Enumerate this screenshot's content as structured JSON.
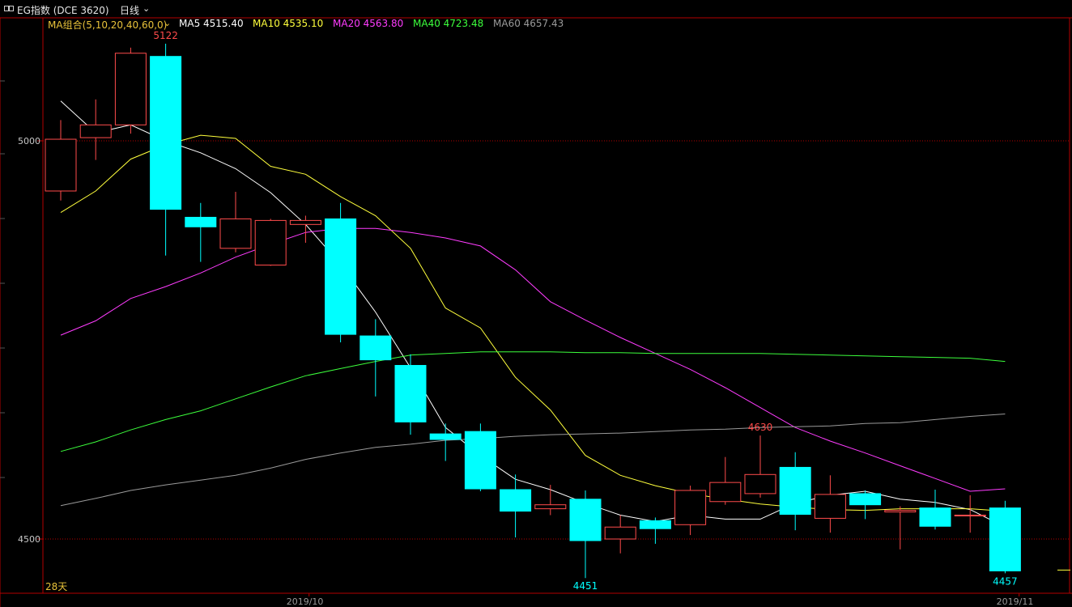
{
  "header": {
    "symbol": "EG指数  (DCE 3620)",
    "period": "日线",
    "period_menu_icon": "chevron-down-icon",
    "window_icon": "window-toggle-icon"
  },
  "legend": {
    "combo": "MA组合(5,10,20,40,60,0)",
    "ma5": "MA5 4515.40",
    "ma10": "MA10 4535.10",
    "ma20": "MA20 4563.80",
    "ma40": "MA40 4723.48",
    "ma60": "MA60 4657.43"
  },
  "colors": {
    "up": "#ff4b4b",
    "down": "#00ffff",
    "ma5": "#ffffff",
    "ma10": "#ffff3c",
    "ma20": "#ff3cff",
    "ma40": "#3cff3c",
    "ma60": "#9a9a9a",
    "frame": "#b40000",
    "combo": "#e8c23a"
  },
  "footer": {
    "days": "28天"
  },
  "chart_data": {
    "type": "candlestick",
    "y_ticks": [
      {
        "value": 5000,
        "label": "5000"
      },
      {
        "value": 4500,
        "label": "4500"
      }
    ],
    "x_labels": [
      {
        "at": 7.1,
        "label": "2019/10"
      },
      {
        "at": 27.4,
        "label": "2019/11"
      }
    ],
    "candles": [
      {
        "open": 4937,
        "close": 5002,
        "high": 5026,
        "low": 4925
      },
      {
        "open": 5004,
        "close": 5020,
        "high": 5052,
        "low": 4976
      },
      {
        "open": 5020,
        "close": 5110,
        "high": 5117,
        "low": 5009
      },
      {
        "open": 5106,
        "close": 4914,
        "high": 5122,
        "low": 4856
      },
      {
        "open": 4904,
        "close": 4892,
        "high": 4922,
        "low": 4848
      },
      {
        "open": 4865,
        "close": 4902,
        "high": 4936,
        "low": 4860
      },
      {
        "open": 4844,
        "close": 4900,
        "high": 4902,
        "low": 4843
      },
      {
        "open": 4895,
        "close": 4900,
        "high": 4906,
        "low": 4872
      },
      {
        "open": 4902,
        "close": 4757,
        "high": 4922,
        "low": 4747
      },
      {
        "open": 4755,
        "close": 4725,
        "high": 4776,
        "low": 4679
      },
      {
        "open": 4718,
        "close": 4647,
        "high": 4732,
        "low": 4631
      },
      {
        "open": 4632,
        "close": 4625,
        "high": 4645,
        "low": 4598
      },
      {
        "open": 4635,
        "close": 4563,
        "high": 4645,
        "low": 4560
      },
      {
        "open": 4562,
        "close": 4535,
        "high": 4581,
        "low": 4502
      },
      {
        "open": 4538,
        "close": 4543,
        "high": 4568,
        "low": 4530
      },
      {
        "open": 4550,
        "close": 4498,
        "high": 4561,
        "low": 4451
      },
      {
        "open": 4500,
        "close": 4515,
        "high": 4530,
        "low": 4482
      },
      {
        "open": 4523,
        "close": 4513,
        "high": 4527,
        "low": 4494
      },
      {
        "open": 4518,
        "close": 4561,
        "high": 4567,
        "low": 4505
      },
      {
        "open": 4547,
        "close": 4571,
        "high": 4603,
        "low": 4543
      },
      {
        "open": 4557,
        "close": 4581,
        "high": 4630,
        "low": 4552
      },
      {
        "open": 4590,
        "close": 4531,
        "high": 4609,
        "low": 4511
      },
      {
        "open": 4526,
        "close": 4556,
        "high": 4580,
        "low": 4508
      },
      {
        "open": 4557,
        "close": 4543,
        "high": 4561,
        "low": 4525
      },
      {
        "open": 4534,
        "close": 4536,
        "high": 4541,
        "low": 4487
      },
      {
        "open": 4539,
        "close": 4516,
        "high": 4562,
        "low": 4512
      },
      {
        "open": 4529,
        "close": 4530,
        "high": 4555,
        "low": 4508
      },
      {
        "open": 4539,
        "close": 4460,
        "high": 4548,
        "low": 4457
      }
    ],
    "annotations": [
      {
        "index": 3,
        "value": 5122,
        "label": "5122",
        "position": "above",
        "color": "up"
      },
      {
        "index": 15,
        "value": 4451,
        "label": "4451",
        "position": "below",
        "color": "down"
      },
      {
        "index": 20,
        "value": 4630,
        "label": "4630",
        "position": "above",
        "color": "up"
      },
      {
        "index": 27,
        "value": 4457,
        "label": "4457",
        "position": "below",
        "color": "down"
      }
    ],
    "moving_averages": [
      {
        "name": "MA5",
        "color": "ma5",
        "start_index": 0,
        "values": [
          5050,
          5010,
          5020,
          5000,
          4985,
          4965,
          4935,
          4895,
          4845,
          4785,
          4715,
          4640,
          4605,
          4575,
          4562,
          4545,
          4530,
          4522,
          4530,
          4525,
          4525,
          4545,
          4555,
          4560,
          4550,
          4546,
          4537,
          4515
        ]
      },
      {
        "name": "MA10",
        "color": "ma10",
        "start_index": 0,
        "values": [
          4910,
          4937,
          4977,
          4995,
          5007,
          5003,
          4968,
          4958,
          4930,
          4906,
          4865,
          4790,
          4765,
          4703,
          4662,
          4605,
          4580,
          4567,
          4557,
          4550,
          4544,
          4540,
          4537,
          4536,
          4538,
          4538,
          4538,
          4535
        ]
      },
      {
        "name": "MA20",
        "color": "ma20",
        "start_index": 0,
        "values": [
          4756,
          4774,
          4802,
          4817,
          4834,
          4854,
          4870,
          4885,
          4890,
          4890,
          4885,
          4878,
          4868,
          4838,
          4798,
          4775,
          4753,
          4733,
          4713,
          4690,
          4665,
          4640,
          4623,
          4608,
          4592,
          4576,
          4560,
          4563
        ]
      },
      {
        "name": "MA40",
        "color": "ma40",
        "start_index": 0,
        "values": [
          4610,
          4622,
          4637,
          4650,
          4661,
          4676,
          4691,
          4705,
          4714,
          4723,
          4731,
          4733,
          4735,
          4735,
          4735,
          4734,
          4734,
          4733,
          4733,
          4733,
          4733,
          4732,
          4731,
          4730,
          4729,
          4728,
          4727,
          4723
        ]
      },
      {
        "name": "MA60",
        "color": "ma60",
        "start_index": 0,
        "values": [
          4542,
          4551,
          4561,
          4568,
          4574,
          4580,
          4589,
          4600,
          4608,
          4615,
          4619,
          4624,
          4626,
          4629,
          4631,
          4632,
          4633,
          4635,
          4637,
          4638,
          4640,
          4641,
          4642,
          4645,
          4646,
          4650,
          4654,
          4657
        ]
      }
    ]
  }
}
